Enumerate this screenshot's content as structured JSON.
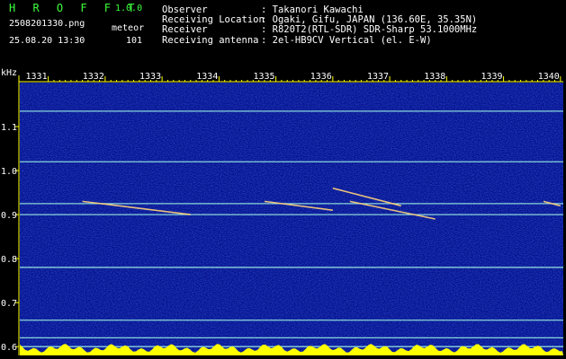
{
  "header": {
    "app_name": "H R O F F T",
    "version": "1.0.0",
    "filename": "2508201330.png",
    "datetime": "25.08.20 13:30",
    "meteor_label": "meteor",
    "meteor_count": "101",
    "observer_label": "Observer",
    "observer_value": ": Takanori Kawachi",
    "location_label": "Receiving Location",
    "location_value": ": Ogaki, Gifu, JAPAN (136.60E, 35.35N)",
    "receiver_label": "Receiver",
    "receiver_value": ": R820T2(RTL-SDR) SDR-Sharp 53.1000MHz",
    "antenna_label": "Receiving antenna",
    "antenna_value": ": 2el-HB9CV Vertical (el. E-W)"
  },
  "colors": {
    "title_green": "#3cff3c",
    "background": "#000000",
    "plot_background": "#05108a",
    "axis_yellow": "#ffff00",
    "signal_cyan": "#9ff5e6"
  },
  "chart_data": {
    "type": "spectrogram",
    "ylabel": "kHz",
    "y_ticks": [
      "1.1",
      "1.0",
      "0.9",
      "0.8",
      "0.7",
      "0.6"
    ],
    "x_ticks": [
      "1331",
      "1332",
      "1333",
      "1334",
      "1335",
      "1336",
      "1337",
      "1338",
      "1339",
      "1340"
    ],
    "ylim": [
      0.58,
      1.2
    ],
    "xlim": [
      1330.5,
      1340.05
    ],
    "carriers_khz": [
      1.135,
      1.02,
      0.925,
      0.9,
      0.78,
      0.66,
      0.62,
      0.6
    ],
    "meteor_traces": [
      {
        "t0": 1331.6,
        "f0": 0.93,
        "t1": 1333.5,
        "f1": 0.9
      },
      {
        "t0": 1334.8,
        "f0": 0.93,
        "t1": 1336.0,
        "f1": 0.91
      },
      {
        "t0": 1336.0,
        "f0": 0.96,
        "t1": 1337.2,
        "f1": 0.92
      },
      {
        "t0": 1336.3,
        "f0": 0.93,
        "t1": 1337.8,
        "f1": 0.89
      },
      {
        "t0": 1339.7,
        "f0": 0.93,
        "t1": 1340.0,
        "f1": 0.92
      }
    ]
  }
}
